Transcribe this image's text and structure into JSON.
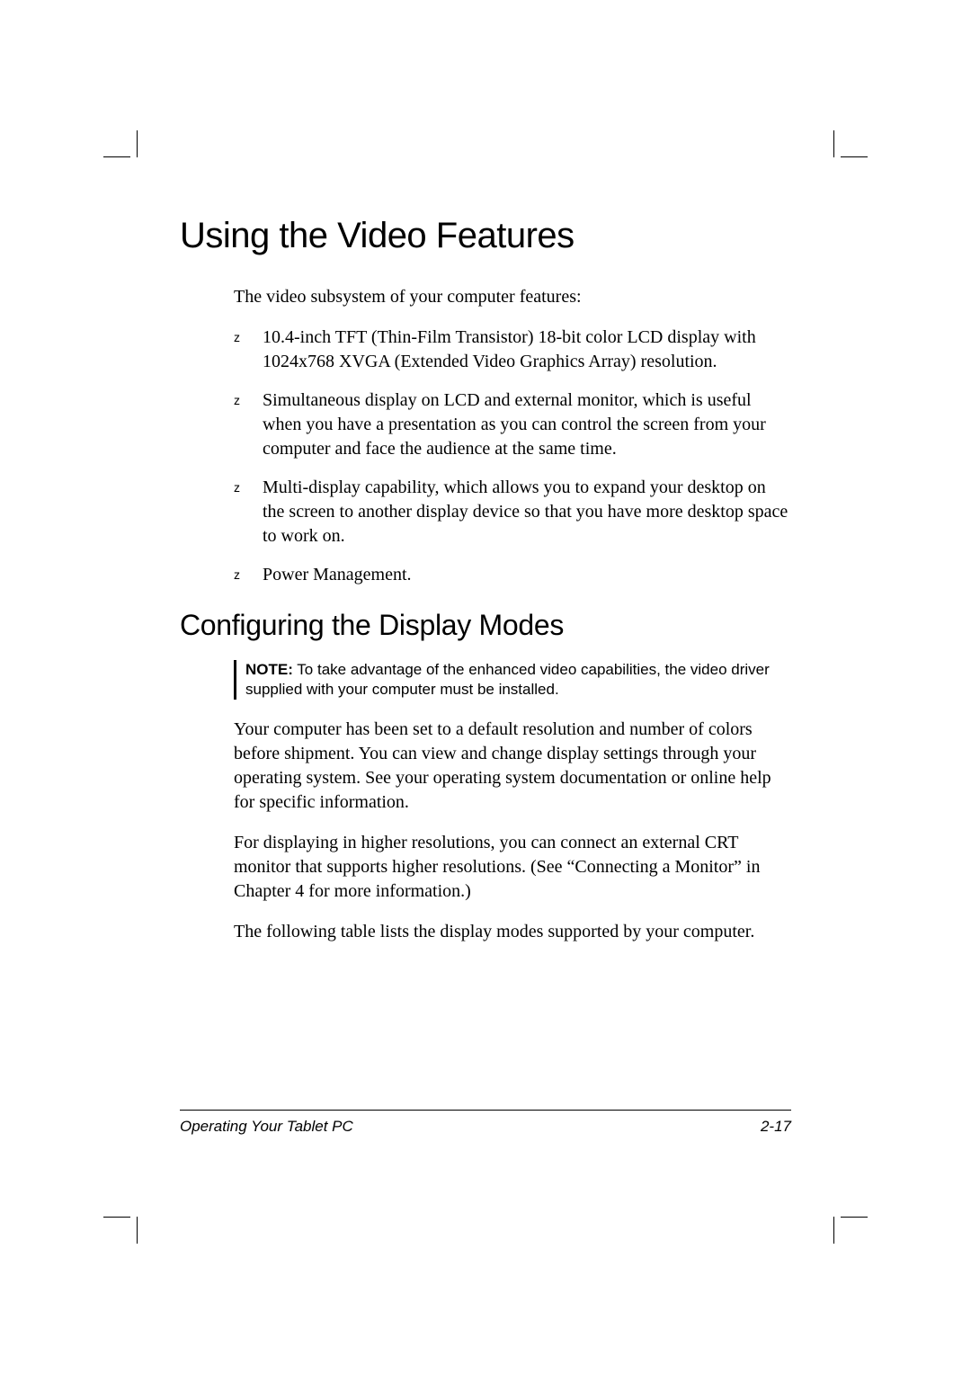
{
  "heading1": "Using the Video Features",
  "intro": "The video subsystem of your computer features:",
  "bullets": [
    "10.4-inch TFT (Thin-Film Transistor) 18-bit color LCD display with 1024x768 XVGA (Extended Video Graphics Array) resolution.",
    "Simultaneous display on LCD and external monitor, which is useful when you have a presentation as you can control the screen from your computer and face the audience at the same time.",
    "Multi-display capability, which allows you to expand your desktop on the screen to another display device so that you have more desktop space to work on.",
    "Power Management."
  ],
  "bullet_marker": "z",
  "heading2": "Configuring the Display Modes",
  "note_label": "NOTE:",
  "note_text": " To take advantage of the enhanced video capabilities, the video driver supplied with your computer must be installed.",
  "para1": "Your computer has been set to a default resolution and number of colors before shipment. You can view and change display settings through your operating system. See your operating system documentation or online help for specific information.",
  "para2": "For displaying in higher resolutions, you can connect an external CRT monitor that supports higher resolutions. (See “Connecting a Monitor” in Chapter 4 for more information.)",
  "para3": "The following table lists the display modes supported by your computer.",
  "footer_left": "Operating Your Tablet PC",
  "footer_right": "2-17"
}
